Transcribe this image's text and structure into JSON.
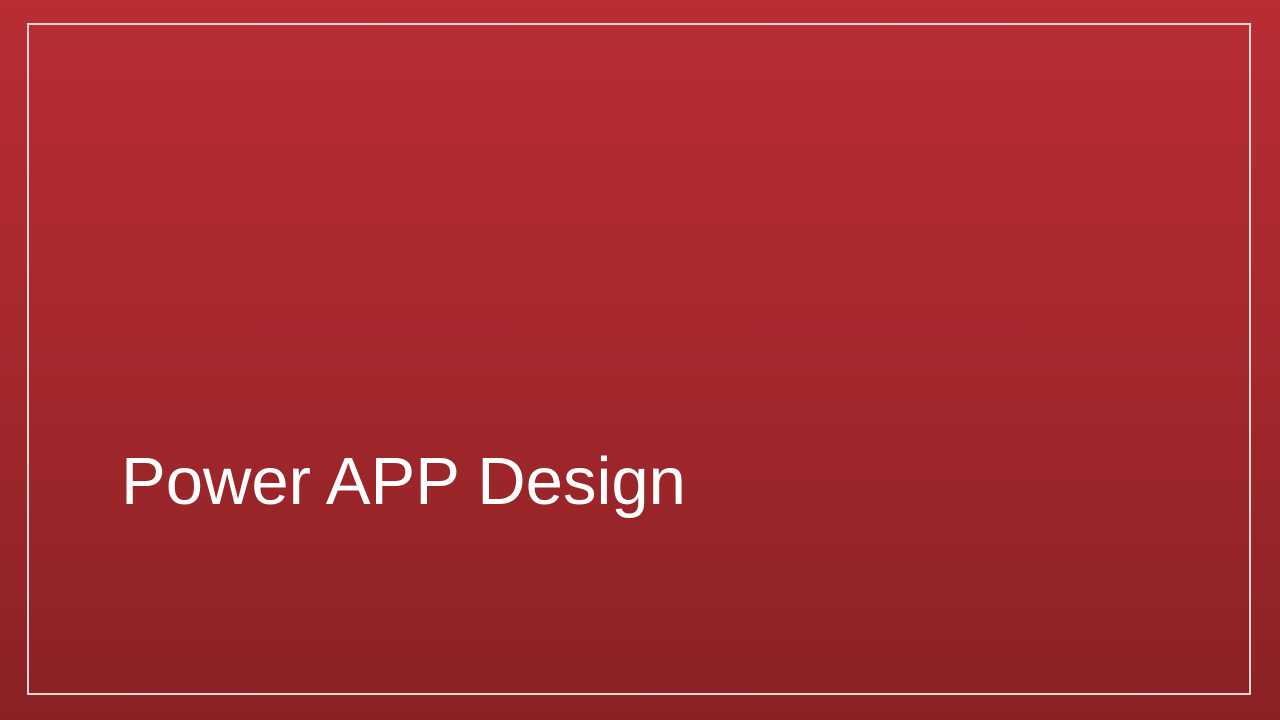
{
  "slide": {
    "title": "Power APP Design"
  },
  "colors": {
    "background_top": "#b92d33",
    "background_bottom": "#8a2124",
    "frame": "#e9d6d6",
    "title_text": "#ffffff"
  }
}
